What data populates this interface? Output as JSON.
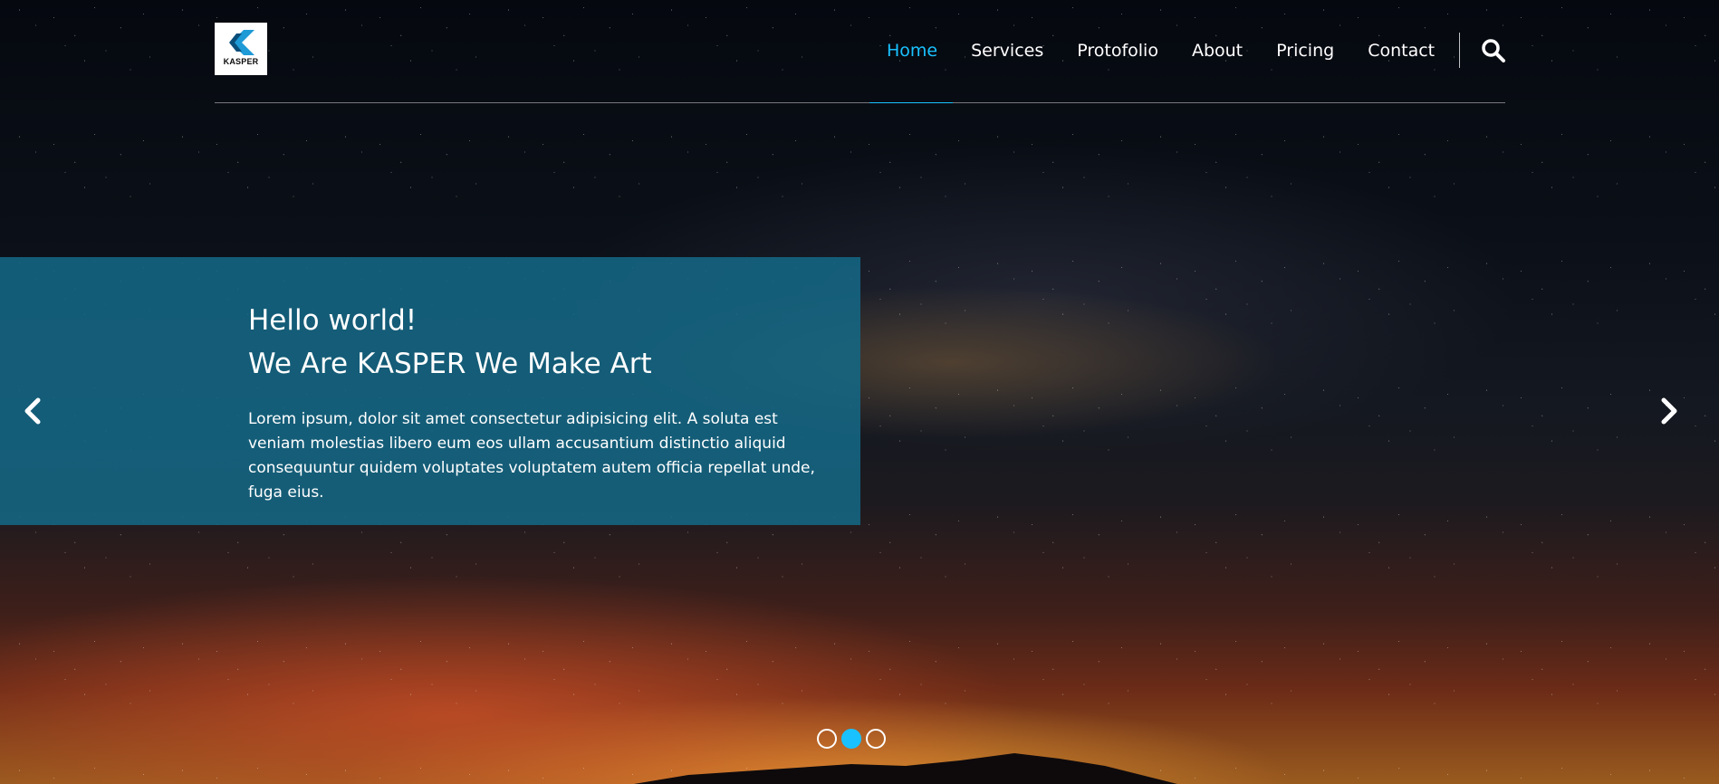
{
  "brand": {
    "logo_text": "KASPER"
  },
  "nav": {
    "items": [
      {
        "label": "Home",
        "active": true
      },
      {
        "label": "Services",
        "active": false
      },
      {
        "label": "Protofolio",
        "active": false
      },
      {
        "label": "About",
        "active": false
      },
      {
        "label": "Pricing",
        "active": false
      },
      {
        "label": "Contact",
        "active": false
      }
    ],
    "search_icon": "search-icon"
  },
  "slider": {
    "heading_line1": "Hello world!",
    "heading_line2": "We Are KASPER We Make Art",
    "text": "Lorem ipsum, dolor sit amet consectetur adipisicing elit. A soluta est veniam molestias libero eum eos ullam accusantium distinctio aliquid consequuntur quidem voluptates voluptatem autem officia repellat unde, fuga eius.",
    "prev_icon": "chevron-left-icon",
    "next_icon": "chevron-right-icon",
    "bullets": [
      {
        "active": false
      },
      {
        "active": true
      },
      {
        "active": false
      }
    ]
  },
  "colors": {
    "accent": "#19c2ff",
    "caption_background": "#146784",
    "text": "#ffffff"
  }
}
